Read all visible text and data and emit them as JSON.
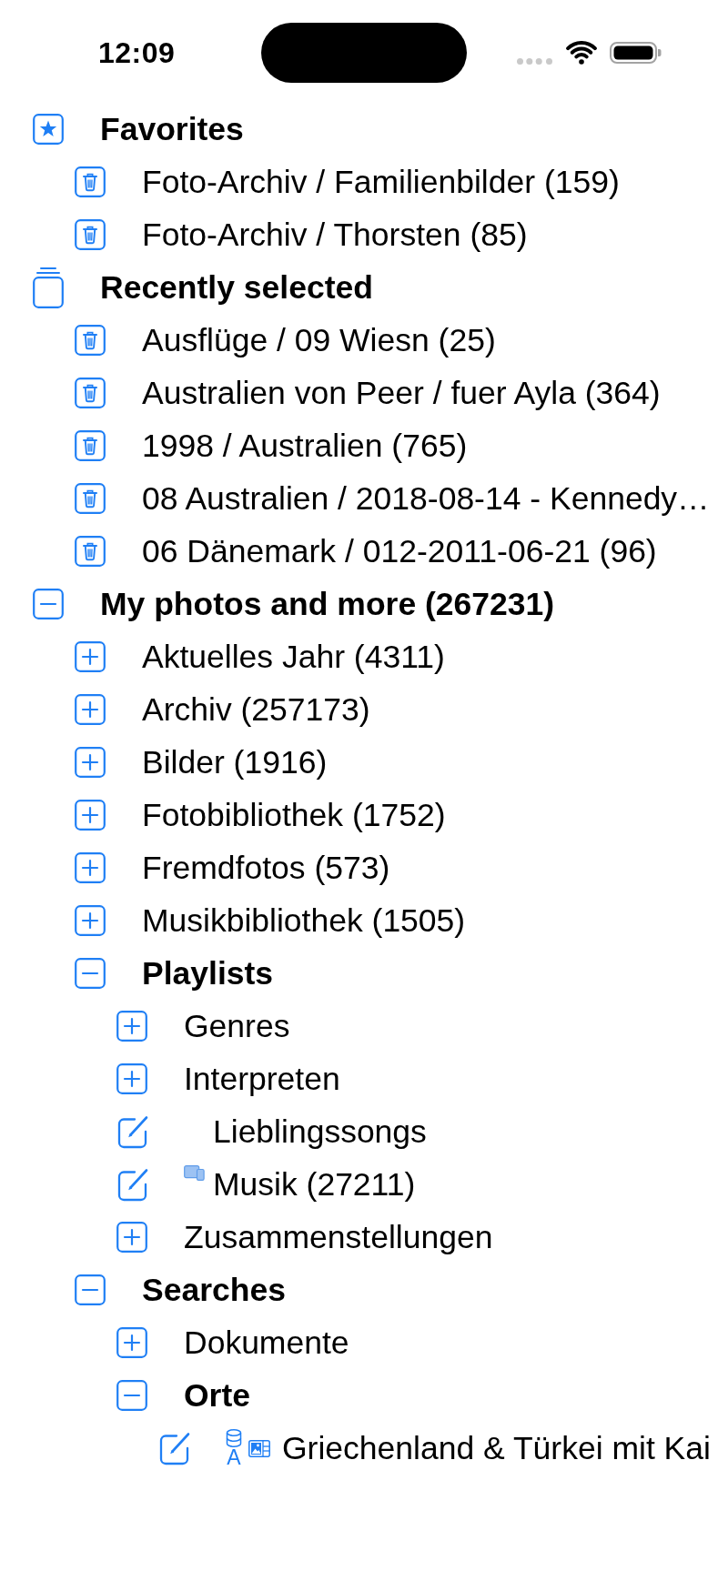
{
  "status_bar": {
    "time": "12:09"
  },
  "tree": [
    {
      "label": "Favorites",
      "kind": "favorites",
      "children": [
        {
          "label": "Foto-Archiv / Familienbilder (159)",
          "kind": "album"
        },
        {
          "label": "Foto-Archiv / Thorsten (85)",
          "kind": "album"
        }
      ]
    },
    {
      "label": "Recently selected",
      "kind": "recent",
      "children": [
        {
          "label": "Ausflüge / 09 Wiesn (25)",
          "kind": "album"
        },
        {
          "label": "Australien von Peer / fuer Ayla (364)",
          "kind": "album"
        },
        {
          "label": "1998 / Australien (765)",
          "kind": "album"
        },
        {
          "label": "08 Australien / 2018-08-14 - Kennedy…",
          "kind": "album"
        },
        {
          "label": "06 Dänemark / 012-2011-06-21 (96)",
          "kind": "album"
        }
      ]
    },
    {
      "label": "My photos and more (267231)",
      "kind": "folder",
      "expanded": true,
      "children": [
        {
          "label": "Aktuelles Jahr (4311)",
          "kind": "folder",
          "expanded": false
        },
        {
          "label": "Archiv (257173)",
          "kind": "folder",
          "expanded": false
        },
        {
          "label": "Bilder (1916)",
          "kind": "folder",
          "expanded": false
        },
        {
          "label": "Fotobibliothek (1752)",
          "kind": "folder",
          "expanded": false
        },
        {
          "label": "Fremdfotos (573)",
          "kind": "folder",
          "expanded": false
        },
        {
          "label": "Musikbibliothek (1505)",
          "kind": "folder",
          "expanded": false
        },
        {
          "label": "Playlists",
          "kind": "folder",
          "expanded": true,
          "children": [
            {
              "label": "Genres",
              "kind": "folder",
              "expanded": false
            },
            {
              "label": "Interpreten",
              "kind": "folder",
              "expanded": false
            },
            {
              "label": "Lieblingssongs",
              "kind": "playlist"
            },
            {
              "label": "Musik (27211)",
              "kind": "synced"
            },
            {
              "label": "Zusammenstellungen",
              "kind": "folder",
              "expanded": false
            }
          ]
        },
        {
          "label": "Searches",
          "kind": "folder",
          "expanded": true,
          "children": [
            {
              "label": "Dokumente",
              "kind": "folder",
              "expanded": false
            },
            {
              "label": "Orte",
              "kind": "folder",
              "expanded": true,
              "children": [
                {
                  "label": "Griechenland & Türkei mit Kai",
                  "kind": "smart",
                  "badge_letter": "A"
                }
              ]
            }
          ]
        }
      ]
    }
  ]
}
